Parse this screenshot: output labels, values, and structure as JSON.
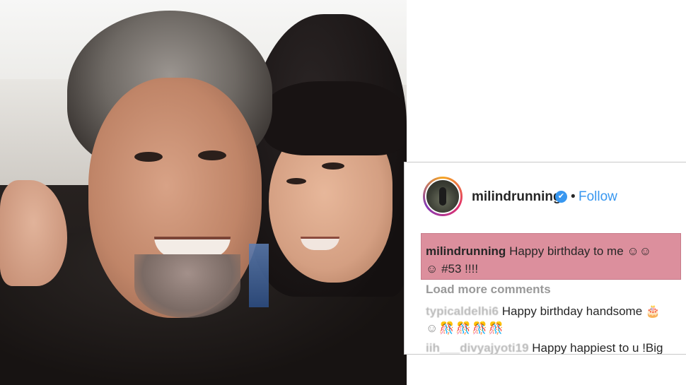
{
  "post": {
    "username": "milindrunning",
    "verified_glyph": "✔",
    "separator": "•",
    "follow_label": "Follow",
    "caption": {
      "author": "milindrunning",
      "text_line1": "Happy birthday to me ☺☺",
      "text_line2": "☺ #53 !!!!"
    },
    "load_more_label": "Load more comments",
    "comments": [
      {
        "author": "typicaldelhi6",
        "text": "Happy birthday handsome 🎂",
        "text_line2": "☺🎊🎊🎊🎊"
      },
      {
        "author": "iih___divyajyoti19",
        "text": "Happy happiest to u !Big"
      }
    ]
  },
  "colors": {
    "highlight": "#dc8f9d",
    "link_blue": "#3897f0",
    "text_dark": "#262626",
    "text_muted": "#999999"
  }
}
